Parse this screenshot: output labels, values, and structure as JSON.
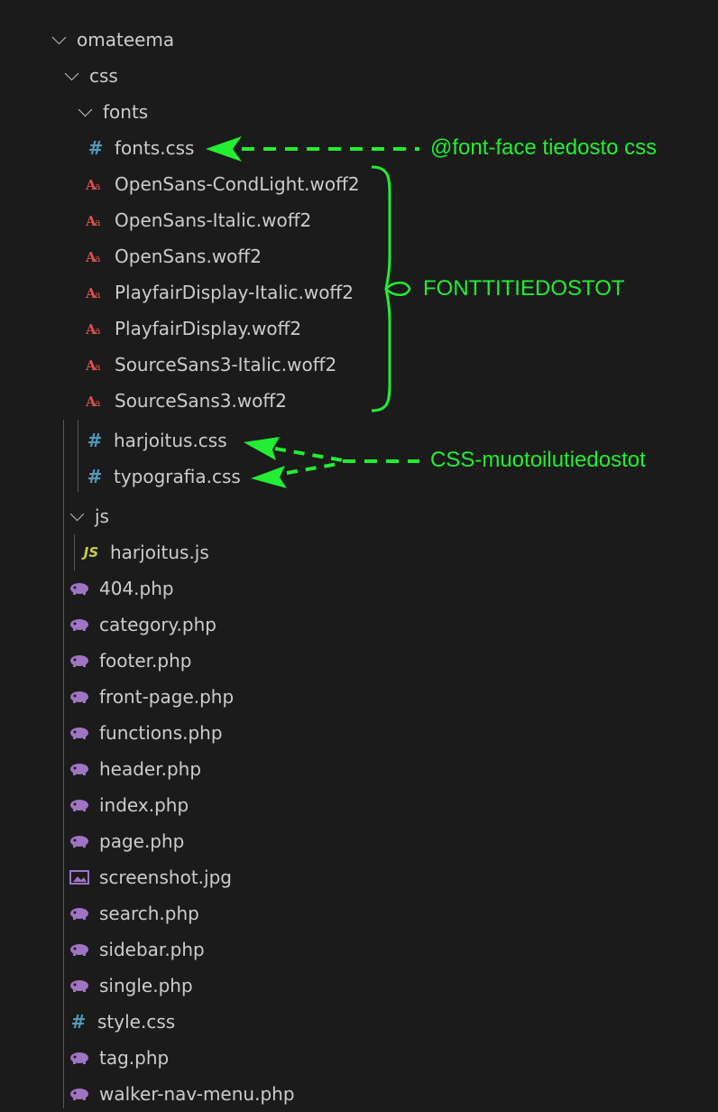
{
  "explorer": {
    "root": {
      "label": "omateema"
    },
    "css_folder": {
      "label": "css"
    },
    "fonts_folder": {
      "label": "fonts"
    },
    "fonts_css": {
      "label": "fonts.css"
    },
    "font_files": [
      {
        "label": "OpenSans-CondLight.woff2"
      },
      {
        "label": "OpenSans-Italic.woff2"
      },
      {
        "label": "OpenSans.woff2"
      },
      {
        "label": "PlayfairDisplay-Italic.woff2"
      },
      {
        "label": "PlayfairDisplay.woff2"
      },
      {
        "label": "SourceSans3-Italic.woff2"
      },
      {
        "label": "SourceSans3.woff2"
      }
    ],
    "css_files": [
      {
        "label": "harjoitus.css"
      },
      {
        "label": "typografia.css"
      }
    ],
    "js_folder": {
      "label": "js"
    },
    "js_file": {
      "label": "harjoitus.js"
    },
    "root_files": [
      {
        "label": "404.php",
        "icon": "php-icon"
      },
      {
        "label": "category.php",
        "icon": "php-icon"
      },
      {
        "label": "footer.php",
        "icon": "php-icon"
      },
      {
        "label": "front-page.php",
        "icon": "php-icon"
      },
      {
        "label": "functions.php",
        "icon": "php-icon"
      },
      {
        "label": "header.php",
        "icon": "php-icon"
      },
      {
        "label": "index.php",
        "icon": "php-icon"
      },
      {
        "label": "page.php",
        "icon": "php-icon"
      },
      {
        "label": "screenshot.jpg",
        "icon": "image-icon"
      },
      {
        "label": "search.php",
        "icon": "php-icon"
      },
      {
        "label": "sidebar.php",
        "icon": "php-icon"
      },
      {
        "label": "single.php",
        "icon": "php-icon"
      },
      {
        "label": "style.css",
        "icon": "hash-icon"
      },
      {
        "label": "tag.php",
        "icon": "php-icon"
      },
      {
        "label": "walker-nav-menu.php",
        "icon": "php-icon"
      }
    ]
  },
  "annotations": {
    "font_face": "@font-face tiedosto css",
    "font_files": "FONTTITIEDOSTOT",
    "css_files": "CSS-muotoilutiedostot"
  },
  "colors": {
    "background": "#1b1b1b",
    "text": "#cccccc",
    "annotation": "#22ee33",
    "css_icon": "#519aba",
    "font_icon": "#d9534f",
    "php_icon": "#a074c4",
    "js_icon": "#cbcb41"
  }
}
